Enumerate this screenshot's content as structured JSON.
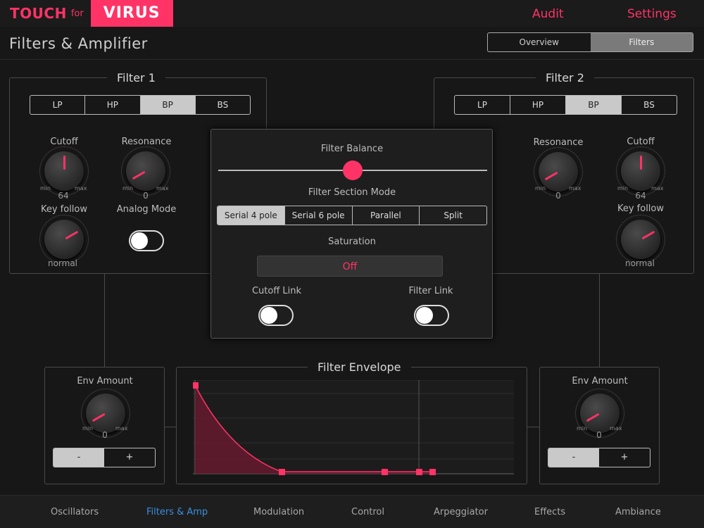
{
  "header": {
    "logo_touch": "TOUCH",
    "logo_for": "for",
    "logo_virus": "VIRUS",
    "audit_label": "Audit",
    "settings_label": "Settings",
    "page_title": "Filters & Amplifier",
    "view_tabs": [
      {
        "label": "Overview",
        "active": false
      },
      {
        "label": "Filters",
        "active": true
      }
    ]
  },
  "filter1": {
    "title": "Filter 1",
    "types": [
      {
        "label": "LP",
        "active": false
      },
      {
        "label": "HP",
        "active": false
      },
      {
        "label": "BP",
        "active": true
      },
      {
        "label": "BS",
        "active": false
      }
    ],
    "cutoff": {
      "label": "Cutoff",
      "value": "64",
      "min": "min",
      "max": "max"
    },
    "resonance": {
      "label": "Resonance",
      "value": "0",
      "min": "min",
      "max": "max"
    },
    "key_follow": {
      "label": "Key follow",
      "value": "normal"
    },
    "analog_mode": {
      "label": "Analog Mode",
      "on": false
    }
  },
  "filter2": {
    "title": "Filter 2",
    "types": [
      {
        "label": "LP",
        "active": false
      },
      {
        "label": "HP",
        "active": false
      },
      {
        "label": "BP",
        "active": true
      },
      {
        "label": "BS",
        "active": false
      }
    ],
    "cutoff": {
      "label": "Cutoff",
      "value": "64",
      "min": "min",
      "max": "max"
    },
    "resonance": {
      "label": "Resonance",
      "value": "0",
      "min": "min",
      "max": "max"
    },
    "key_follow": {
      "label": "Key follow",
      "value": "normal"
    }
  },
  "overlay": {
    "balance_label": "Filter Balance",
    "balance_value": 0.5,
    "mode_label": "Filter Section Mode",
    "modes": [
      {
        "label": "Serial 4 pole",
        "active": true
      },
      {
        "label": "Serial 6 pole",
        "active": false
      },
      {
        "label": "Parallel",
        "active": false
      },
      {
        "label": "Split",
        "active": false
      }
    ],
    "saturation_label": "Saturation",
    "saturation_value": "Off",
    "cutoff_link_label": "Cutoff Link",
    "filter_link_label": "Filter Link"
  },
  "env_left": {
    "label": "Env Amount",
    "value": "0",
    "min": "min",
    "max": "max",
    "minus": "-",
    "plus": "+"
  },
  "env_right": {
    "label": "Env Amount",
    "value": "0",
    "min": "min",
    "max": "max",
    "minus": "-",
    "plus": "+"
  },
  "envelope": {
    "title": "Filter Envelope"
  },
  "colors": {
    "accent": "#ff3366",
    "active_nav": "#3a8fe0"
  },
  "nav": [
    {
      "label": "Oscillators",
      "active": false
    },
    {
      "label": "Filters & Amp",
      "active": true
    },
    {
      "label": "Modulation",
      "active": false
    },
    {
      "label": "Control",
      "active": false
    },
    {
      "label": "Arpeggiator",
      "active": false
    },
    {
      "label": "Effects",
      "active": false
    },
    {
      "label": "Ambiance",
      "active": false
    }
  ]
}
